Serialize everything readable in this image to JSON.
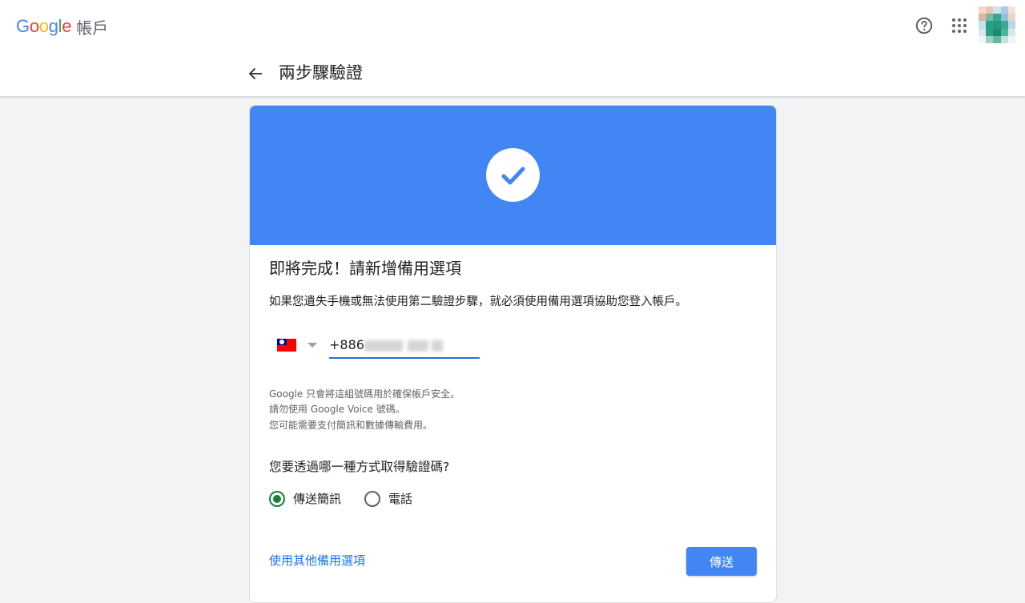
{
  "header": {
    "logo_text": "Google",
    "product": "帳戶",
    "help_icon": "help-circle-icon",
    "apps_icon": "apps-grid-icon",
    "avatar_colors": [
      "#f6d9c9",
      "#e9c6b8",
      "#cfe3f0",
      "#a9cde8",
      "#f2e4d8",
      "#d8b7a6",
      "#7ab8a3",
      "#35a88b",
      "#8fc0dd",
      "#e8d6cc",
      "#c9dfe9",
      "#27a083",
      "#1f9c80",
      "#3ba98e",
      "#b9d6ea",
      "#d8e9f3",
      "#2aa086",
      "#188a6e",
      "#4fb39b",
      "#d7e7ef",
      "#f0f4f6",
      "#9fcfc3",
      "#5eb8a2",
      "#c6e1db",
      "#eef3f6"
    ]
  },
  "page": {
    "back_icon": "arrow-back-icon",
    "title": "兩步驟驗證"
  },
  "card": {
    "banner_color": "#4285f4",
    "check_icon": "check-circle-icon",
    "heading": "即將完成！請新增備用選項",
    "description": "如果您遺失手機或無法使用第二驗證步驟，就必須使用備用選項協助您登入帳戶。",
    "country": "Taiwan",
    "phone_prefix": "+886",
    "notes": [
      "Google 只會將這組號碼用於確保帳戶安全。",
      "請勿使用 Google Voice 號碼。",
      "您可能需要支付簡訊和數據傳輸費用。"
    ],
    "question": "您要透過哪一種方式取得驗證碼?",
    "options": [
      {
        "label": "傳送簡訊",
        "selected": true
      },
      {
        "label": "電話",
        "selected": false
      }
    ],
    "other_options_link": "使用其他備用選項",
    "send_button": "傳送"
  }
}
